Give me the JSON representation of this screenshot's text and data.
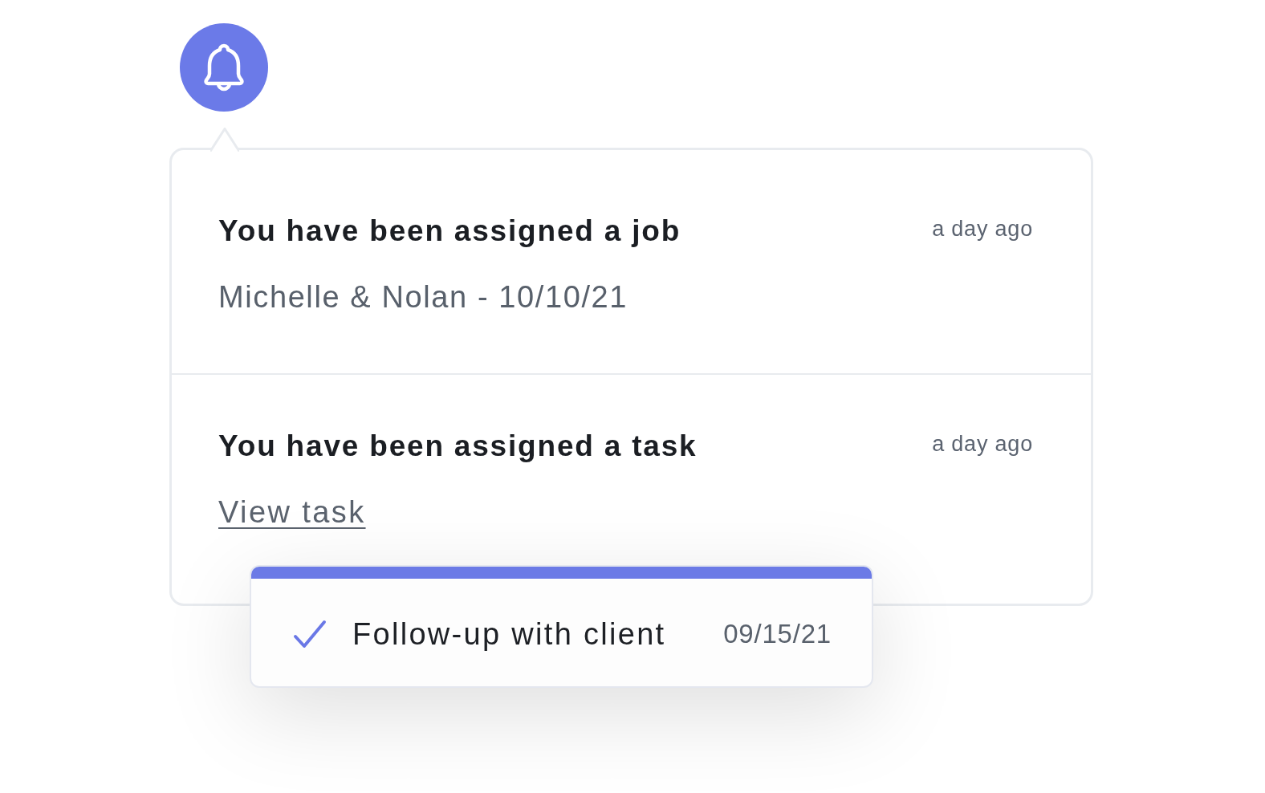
{
  "notifications": [
    {
      "title": "You have been assigned a job",
      "time": "a day ago",
      "detail": {
        "kind": "text",
        "text": "Michelle & Nolan - 10/10/21"
      }
    },
    {
      "title": "You have been assigned a task",
      "time": "a day ago",
      "detail": {
        "kind": "link",
        "text": "View task"
      }
    }
  ],
  "task_card": {
    "checked": true,
    "label": "Follow-up with client",
    "date": "09/15/21"
  }
}
